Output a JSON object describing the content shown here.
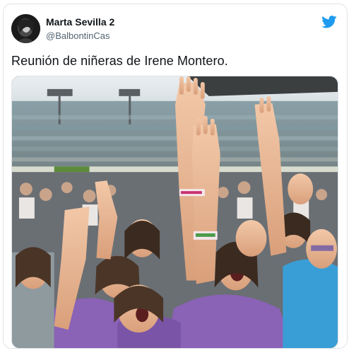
{
  "tweet": {
    "author_name": "Marta Sevilla 2",
    "author_handle": "@BalbontinCas",
    "text": "Reunión de niñeras de Irene Montero."
  },
  "icons": {
    "brand": "twitter-bird-icon",
    "avatar": "profile-photo"
  },
  "colors": {
    "brand_blue": "#1d9bf0",
    "shirt_purple": "#8a62b6"
  }
}
